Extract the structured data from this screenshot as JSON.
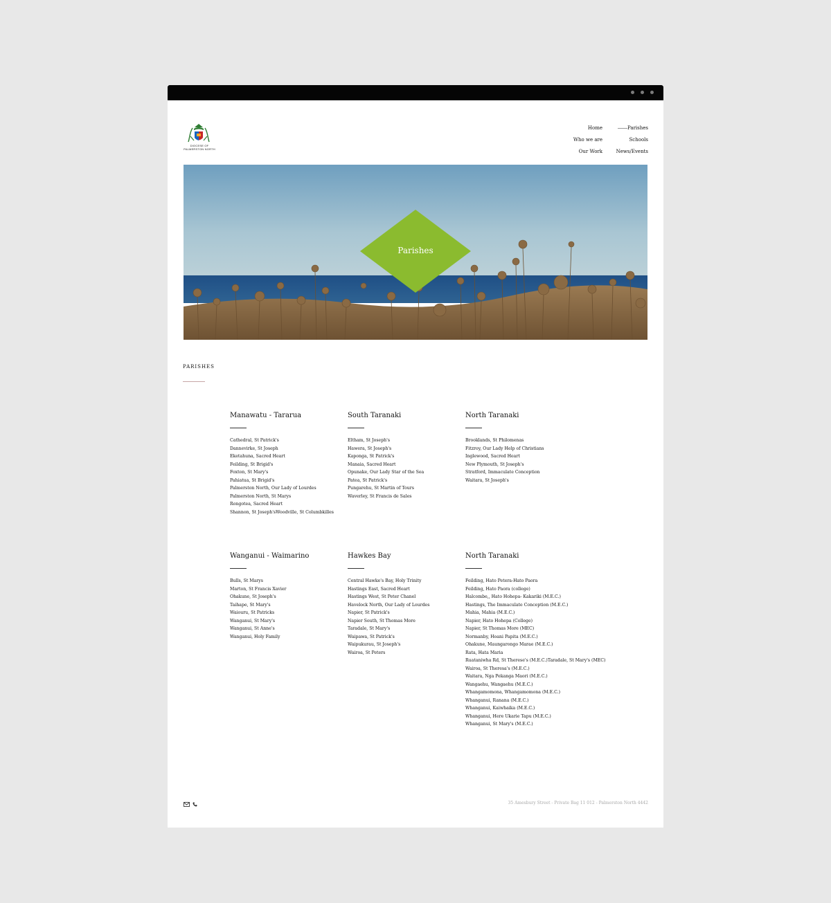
{
  "site": {
    "logo_caption": "DIOCESE OF\nPALMERSTON NORTH"
  },
  "nav": {
    "left": [
      {
        "label": "Home"
      },
      {
        "label": "Who we are"
      },
      {
        "label": "Our Work"
      }
    ],
    "right": [
      {
        "label": "Parishes",
        "active": true
      },
      {
        "label": "Schools"
      },
      {
        "label": "News/Events"
      }
    ]
  },
  "hero": {
    "title": "Parishes",
    "accent_color": "#8bbb2f"
  },
  "section": {
    "label": "PARISHES"
  },
  "regions": [
    {
      "name": "Manawatu - Tararua",
      "parishes": [
        "Cathedral, St Patrick's",
        "Dannevirke, St Joseph",
        "Eketahuna, Sacred Heart",
        "Feilding, St Brigid's",
        "Foxton, St Mary's",
        "Pahiatua, St Brigid's",
        "Palmerston North, Our Lady of Lourdes",
        "Palmerston North, St Marys",
        "Rongotea, Sacred Heart",
        "Shannon, St Joseph'sWoodville, St Columbkilles"
      ]
    },
    {
      "name": "South Taranaki",
      "parishes": [
        "Eltham, St Joseph's",
        "Hawera, St Joseph's",
        " Kaponga, St Patrick's",
        "Manaia, Sacred Heart",
        "Opunake, Our Lady Star of the Sea",
        "Patea, St Patrick's",
        "Pungarehu, St Martin of Tours",
        "Waverley, St Francis de Sales"
      ]
    },
    {
      "name": "North Taranaki",
      "parishes": [
        "Brooklands, St Philomenas",
        "Fitzroy, Our Lady Help of Christians",
        "Inglewood, Sacred Heart",
        "New Plymouth, St Joseph's",
        "Stratford, Immaculate Conception",
        "Waitara, St Joseph's"
      ]
    },
    {
      "name": "Wanganui - Waimarino",
      "parishes": [
        "Bulls, St Marys",
        "Marton, St Francis Xavier",
        "Ohakune, St Joseph's",
        "Taihape, St Mary's",
        "Waiouru, St Patricks",
        "Wanganui, St Mary's",
        "Wanganui, St Anne's",
        "Wanganui, Holy Family"
      ]
    },
    {
      "name": "Hawkes Bay",
      "parishes": [
        "Central Hawke's Bay, Holy Trinity",
        "Hastings East, Sacred Heart",
        "Hastings West, St Peter Chanel",
        "Havelock North, Our Lady of Lourdes",
        "Napier, St Patrick's",
        "Napier South, St Thomas More",
        "Taradale, St Mary's",
        "Waipawa, St Patrick's",
        "Waipukurau, St Joseph's",
        "Wairoa, St Peters"
      ]
    },
    {
      "name": "North Taranaki",
      "parishes": [
        "Feilding, Hato Petera-Hato Paora",
        "Feilding, Hato Paora (college)",
        "Halcombe,, Hato Hohepa- Kakariki (M.E.C.)",
        "Hastings, The Immaculate Conception (M.E.C.)",
        "Mahia, Mahia (M.E.C.)",
        "Napier, Hato Hohepa (College)",
        "Napier, St Thomas More (MEC)",
        "Normanby, Hoani Papita (M.E.C.)",
        "Ohakune, Maungarongo Marae (M.E.C.)",
        "Rata, Hata Maria",
        "Ruataniwha Rd, St Therese's (M.E.C.)Taradale, St Mary's (MEC)",
        "Wairoa, St Theresa's (M.E.C.)",
        "Waitara, Nga Pekanga Maori (M.E.C.)",
        "Wangaehu, Wangaehu (M.E.C.)",
        "Whangamomona, Whangamomona (M.E.C.)",
        "Whanganui, Ranana (M.E.C.)",
        "Whanganui, Kaiwhaika (M.E.C.)",
        "Whanganui, Here Ukarie Tapu (M.E.C.)",
        "Whanganui, St Mary's (M.E.C.)"
      ]
    }
  ],
  "footer": {
    "address": "35 Amesbury Street - Private Bag 11 012 - Palmerston North 4442",
    "icons": [
      "mail-icon",
      "phone-icon"
    ]
  }
}
